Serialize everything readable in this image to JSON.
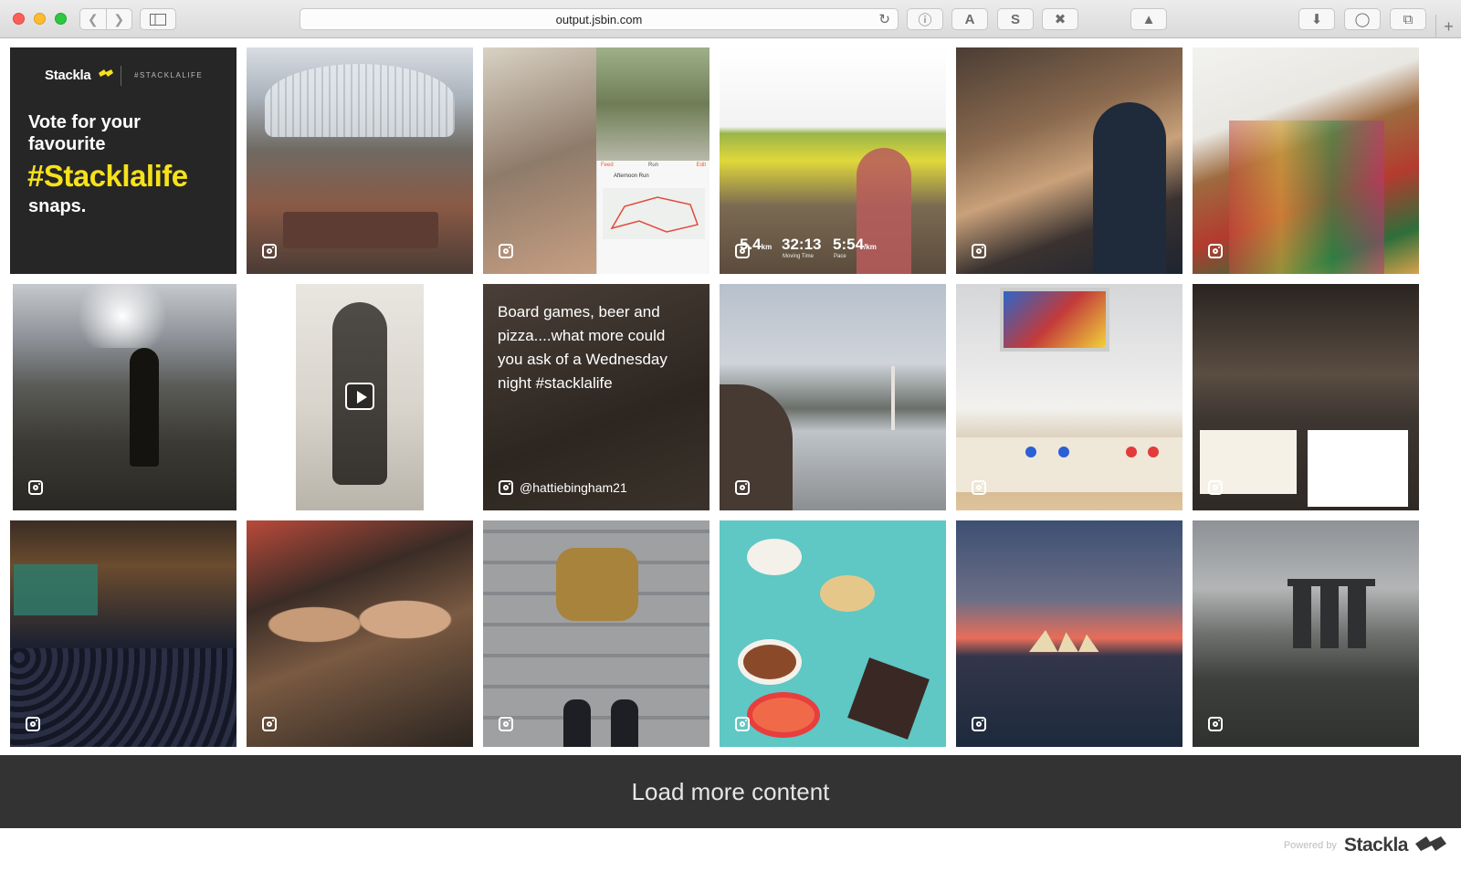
{
  "browser": {
    "url": "output.jsbin.com",
    "toolbar_letters": [
      "A",
      "S"
    ]
  },
  "promo": {
    "brand": "Stackla",
    "hashtag_small": "#STACKLALIFE",
    "headline_line1": "Vote for your",
    "headline_line2": "favourite",
    "hashtag_big": "#Stacklalife",
    "headline_end": "snaps.",
    "accent_color": "#f5e21b"
  },
  "running_tile": {
    "distance": "5.4",
    "distance_unit": "km",
    "moving_time": "32:13",
    "moving_time_label": "Moving Time",
    "pace": "5:54",
    "pace_unit": "/km",
    "pace_label": "Pace",
    "app_title": "Afternoon Run",
    "app_tabs": [
      "Feed",
      "Run",
      "Edit"
    ]
  },
  "text_tile": {
    "caption": "Board games, beer and pizza....what more could you ask of a Wednesday night #stacklalife",
    "handle": "@hattiebingham21"
  },
  "load_more": {
    "label": "Load more content"
  },
  "footer": {
    "powered_by": "Powered by",
    "brand": "Stackla"
  }
}
